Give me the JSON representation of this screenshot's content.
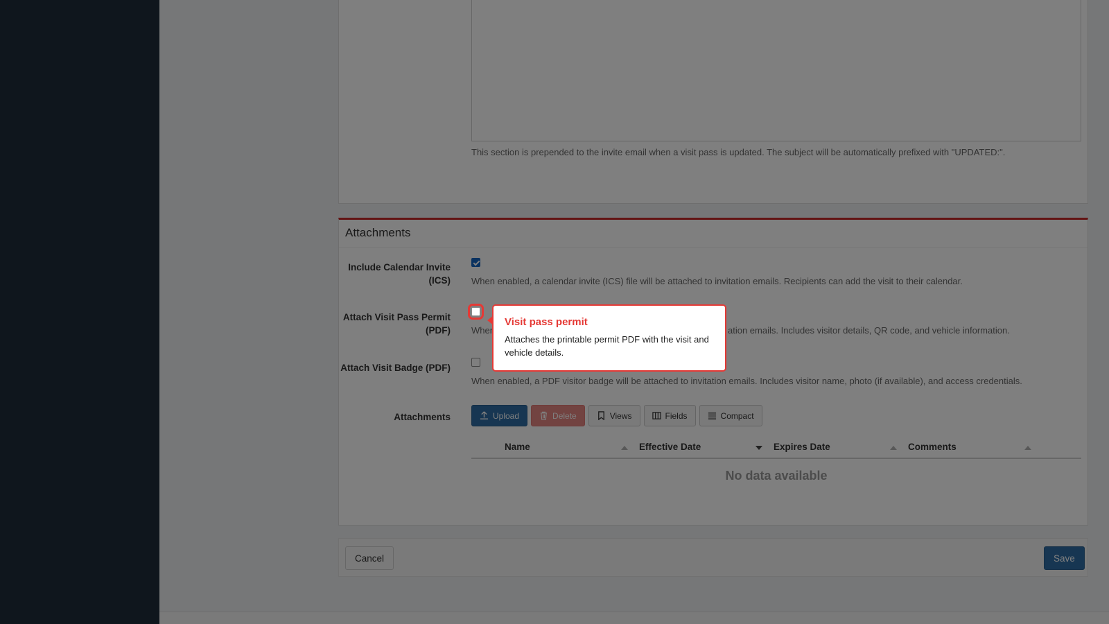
{
  "top_section": {
    "help_text": "This section is prepended to the invite email when a visit pass is updated. The subject will be automatically prefixed with \"UPDATED:\"."
  },
  "attachments_box": {
    "title": "Attachments",
    "fields": [
      {
        "label": "Include Calendar Invite (ICS)",
        "checked": true,
        "help": "When enabled, a calendar invite (ICS) file will be attached to invitation emails. Recipients can add the visit to their calendar."
      },
      {
        "label": "Attach Visit Pass Permit (PDF)",
        "checked": false,
        "help_visible_start": "When",
        "help_visible_end": "ation emails. Includes visitor details, QR code, and vehicle information."
      },
      {
        "label": "Attach Visit Badge (PDF)",
        "checked": false,
        "help": "When enabled, a PDF visitor badge will be attached to invitation emails. Includes visitor name, photo (if available), and access credentials."
      }
    ],
    "attachments_label": "Attachments",
    "toolbar": {
      "upload": "Upload",
      "delete": "Delete",
      "views": "Views",
      "fields": "Fields",
      "compact": "Compact"
    },
    "table": {
      "columns": [
        "Name",
        "Effective Date",
        "Expires Date",
        "Comments"
      ],
      "empty_message": "No data available"
    }
  },
  "actions": {
    "cancel": "Cancel",
    "save": "Save"
  },
  "popover": {
    "title": "Visit pass permit",
    "body": "Attaches the printable permit PDF with the visit and vehicle details."
  },
  "colors": {
    "primary": "#2e6da4",
    "danger": "#d9534f",
    "highlight": "#e53935",
    "sidebar": "#1f2d3a"
  }
}
